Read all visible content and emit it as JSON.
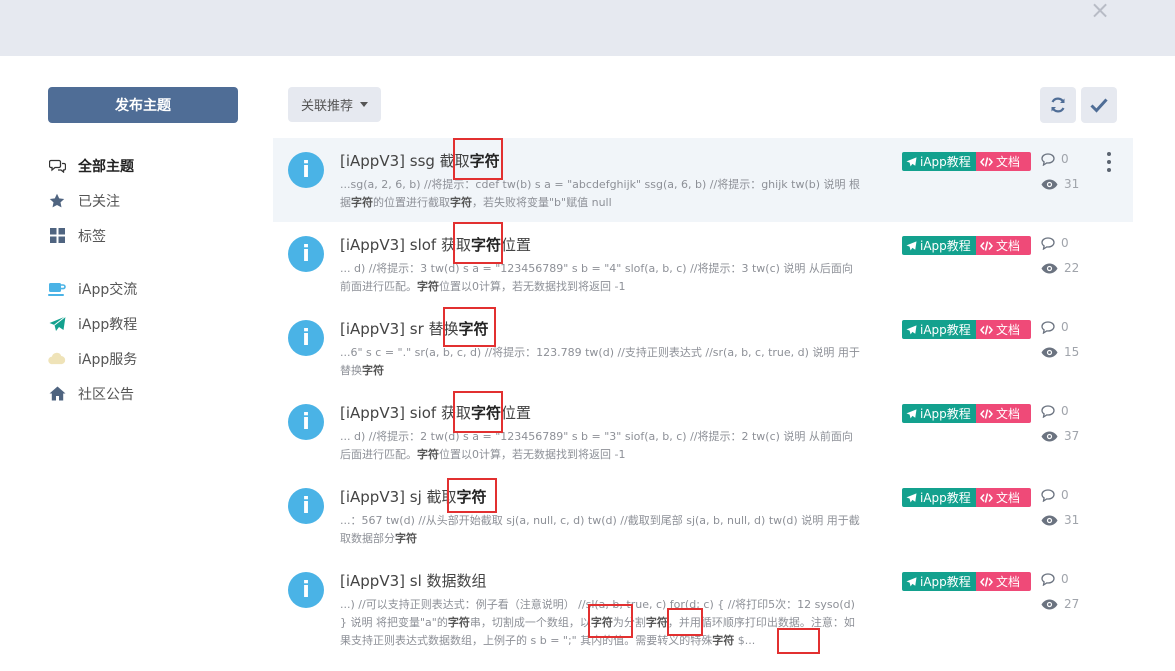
{
  "header": {
    "close_glyph": "×"
  },
  "sidebar": {
    "publish_label": "发布主题",
    "items": [
      {
        "label": "全部主题",
        "icon": "chat-bubbles-icon",
        "active": true
      },
      {
        "label": "已关注",
        "icon": "star-icon"
      },
      {
        "label": "标签",
        "icon": "grid-icon"
      },
      {
        "label": "iApp交流",
        "icon": "coffee-cup-icon"
      },
      {
        "label": "iApp教程",
        "icon": "paper-plane-icon"
      },
      {
        "label": "iApp服务",
        "icon": "cloud-icon"
      },
      {
        "label": "社区公告",
        "icon": "home-icon"
      }
    ]
  },
  "toolbar": {
    "sort_label": "关联推荐",
    "refresh_icon": "refresh-icon",
    "check_icon": "check-icon"
  },
  "tags": {
    "tutorial": "iApp教程",
    "docs": "文档"
  },
  "discussions": [
    {
      "avatar_letter": "i",
      "title_prefix": "[iAppV3] ssg 截取",
      "title_keyword": "字符",
      "title_suffix": "",
      "excerpt_parts": [
        "...sg(a, 2, 6, b) //将提示：cdef tw(b) s a = \"abcdefghijk\" ssg(a, 6, b) //将提示：ghijk tw(b) 说明 根据",
        "字符",
        "的位置进行截取",
        "字符",
        "，若失败将变量\"b\"赋值 null"
      ],
      "comments": "0",
      "views": "31"
    },
    {
      "avatar_letter": "i",
      "title_prefix": "[iAppV3] slof 获取",
      "title_keyword": "字符",
      "title_suffix": "位置",
      "excerpt_parts": [
        "... d) //将提示：3 tw(d) s a = \"123456789\" s b = \"4\" slof(a, b, c) //将提示：3 tw(c) 说明 从后面向前面进行匹配。",
        "字符",
        "位置以0计算，若无数据找到将返回 -1",
        "",
        ""
      ],
      "comments": "0",
      "views": "22"
    },
    {
      "avatar_letter": "i",
      "title_prefix": "[iAppV3] sr 替换",
      "title_keyword": "字符",
      "title_suffix": "",
      "excerpt_parts": [
        "...6\" s c = \".\" sr(a, b, c, d) //将提示：123.789 tw(d) //支持正则表达式 //sr(a, b, c, true, d) 说明 用于替换",
        "字符",
        "",
        "",
        ""
      ],
      "comments": "0",
      "views": "15"
    },
    {
      "avatar_letter": "i",
      "title_prefix": "[iAppV3] siof 获取",
      "title_keyword": "字符",
      "title_suffix": "位置",
      "excerpt_parts": [
        "... d) //将提示：2 tw(d) s a = \"123456789\" s b = \"3\" siof(a, b, c) //将提示：2 tw(c) 说明 从前面向后面进行匹配。",
        "字符",
        "位置以0计算，若无数据找到将返回 -1",
        "",
        ""
      ],
      "comments": "0",
      "views": "37"
    },
    {
      "avatar_letter": "i",
      "title_prefix": "[iAppV3] sj 截取",
      "title_keyword": "字符",
      "title_suffix": "",
      "excerpt_parts": [
        "...：567 tw(d) //从头部开始截取 sj(a, null, c, d) tw(d) //截取到尾部 sj(a, b, null, d) tw(d) 说明 用于截取数据部分",
        "字符",
        "",
        "",
        ""
      ],
      "comments": "0",
      "views": "31"
    },
    {
      "avatar_letter": "i",
      "title_prefix": "[iAppV3] sl 数据数组",
      "title_keyword": "",
      "title_suffix": "",
      "excerpt_parts": [
        "...) //可以支持正则表达式：例子看（注意说明） //sl(a, b, true, c) for(d; c) { //将打印5次：12 syso(d) } 说明 将把变量\"a\"的",
        "字符",
        "串，切割成一个数组，以",
        "字符",
        "为分割",
        "字符",
        "，并用循环顺序打印出数据。注意：如果支持正则表达式数据数组，上例子的 s b = \";\" 其内的值。需要转义的特殊",
        "字符",
        " $..."
      ],
      "comments": "0",
      "views": "27"
    }
  ]
}
